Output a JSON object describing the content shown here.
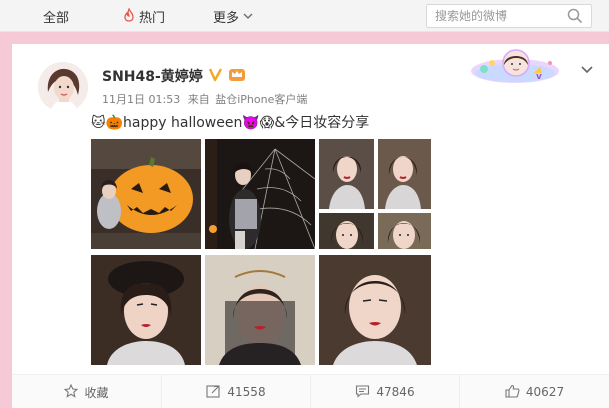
{
  "nav": {
    "tabs": [
      {
        "label": "全部"
      },
      {
        "label": "热门",
        "icon": "fire-icon"
      },
      {
        "label": "更多",
        "icon": "chevron-down-icon"
      }
    ],
    "search_placeholder": "搜索她的微博"
  },
  "post": {
    "author": "SNH48-黄婷婷",
    "verified": true,
    "date": "11月1日 01:53",
    "source_prefix": "来自",
    "source": "盐仓iPhone客户端",
    "text": "🐱🎃happy halloween👿😱&今日妆容分享"
  },
  "actions": {
    "favorite": "收藏",
    "repost": "41558",
    "comment": "47846",
    "like": "40627"
  },
  "colors": {
    "page_bg": "#f6c9d6",
    "verified_badge": "#f5a623",
    "accent_fire": "#e8574a"
  }
}
